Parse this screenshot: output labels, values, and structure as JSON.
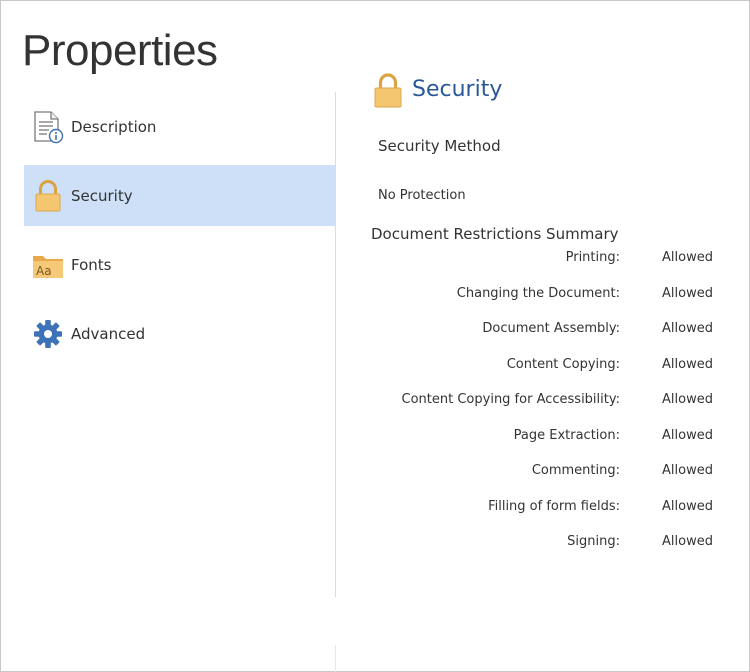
{
  "window": {
    "title": "Properties"
  },
  "sidebar": {
    "items": [
      {
        "label": "Description",
        "icon": "document-info-icon",
        "selected": false
      },
      {
        "label": "Security",
        "icon": "lock-icon",
        "selected": true
      },
      {
        "label": "Fonts",
        "icon": "fonts-folder-icon",
        "selected": false
      },
      {
        "label": "Advanced",
        "icon": "gear-icon",
        "selected": false
      }
    ]
  },
  "main": {
    "section_title": "Security",
    "section_icon": "lock-icon",
    "security_method_label": "Security Method",
    "security_method_value": "No Protection",
    "summary_label": "Document Restrictions Summary",
    "restrictions": [
      {
        "name": "Printing:",
        "value": "Allowed"
      },
      {
        "name": "Changing the Document:",
        "value": "Allowed"
      },
      {
        "name": "Document Assembly:",
        "value": "Allowed"
      },
      {
        "name": "Content Copying:",
        "value": "Allowed"
      },
      {
        "name": "Content Copying for Accessibility:",
        "value": "Allowed"
      },
      {
        "name": "Page Extraction:",
        "value": "Allowed"
      },
      {
        "name": "Commenting:",
        "value": "Allowed"
      },
      {
        "name": "Filling of form fields:",
        "value": "Allowed"
      },
      {
        "name": "Signing:",
        "value": "Allowed"
      }
    ]
  },
  "colors": {
    "selected_background": "#cde0f7",
    "section_title": "#2b579a",
    "lock_body": "#f3c66f",
    "lock_shackle": "#d9a441",
    "gear": "#3e72b8",
    "folder": "#f0b85a"
  }
}
